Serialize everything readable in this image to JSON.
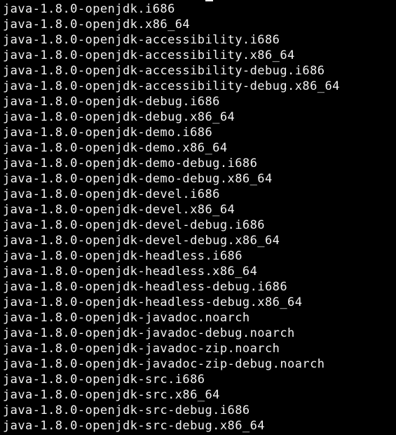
{
  "terminal": {
    "background_color": "#000000",
    "text_color": "#f2f2f2",
    "lines": [
      "java-1.8.0-openjdk.i686",
      "java-1.8.0-openjdk.x86_64",
      "java-1.8.0-openjdk-accessibility.i686",
      "java-1.8.0-openjdk-accessibility.x86_64",
      "java-1.8.0-openjdk-accessibility-debug.i686",
      "java-1.8.0-openjdk-accessibility-debug.x86_64",
      "java-1.8.0-openjdk-debug.i686",
      "java-1.8.0-openjdk-debug.x86_64",
      "java-1.8.0-openjdk-demo.i686",
      "java-1.8.0-openjdk-demo.x86_64",
      "java-1.8.0-openjdk-demo-debug.i686",
      "java-1.8.0-openjdk-demo-debug.x86_64",
      "java-1.8.0-openjdk-devel.i686",
      "java-1.8.0-openjdk-devel.x86_64",
      "java-1.8.0-openjdk-devel-debug.i686",
      "java-1.8.0-openjdk-devel-debug.x86_64",
      "java-1.8.0-openjdk-headless.i686",
      "java-1.8.0-openjdk-headless.x86_64",
      "java-1.8.0-openjdk-headless-debug.i686",
      "java-1.8.0-openjdk-headless-debug.x86_64",
      "java-1.8.0-openjdk-javadoc.noarch",
      "java-1.8.0-openjdk-javadoc-debug.noarch",
      "java-1.8.0-openjdk-javadoc-zip.noarch",
      "java-1.8.0-openjdk-javadoc-zip-debug.noarch",
      "java-1.8.0-openjdk-src.i686",
      "java-1.8.0-openjdk-src.x86_64",
      "java-1.8.0-openjdk-src-debug.i686",
      "java-1.8.0-openjdk-src-debug.x86_64"
    ]
  }
}
